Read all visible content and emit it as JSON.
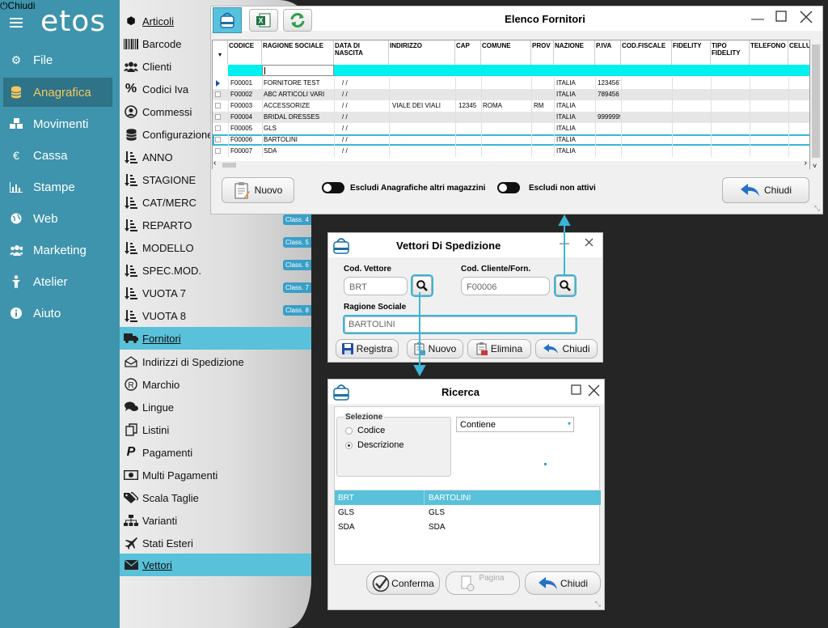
{
  "nav": {
    "logo": "etos",
    "items": [
      {
        "label": "File",
        "icon": "gear-icon",
        "active": false
      },
      {
        "label": "Anagrafica",
        "icon": "database-icon",
        "active": true
      },
      {
        "label": "Movimenti",
        "icon": "cubes-icon",
        "active": false
      },
      {
        "label": "Cassa",
        "icon": "euro-icon",
        "active": false
      },
      {
        "label": "Stampe",
        "icon": "bar-chart-icon",
        "active": false
      },
      {
        "label": "Web",
        "icon": "globe-icon",
        "active": false
      },
      {
        "label": "Marketing",
        "icon": "users-icon",
        "active": false
      },
      {
        "label": "Atelier",
        "icon": "person-icon",
        "active": false
      },
      {
        "label": "Aiuto",
        "icon": "info-icon",
        "active": false
      }
    ],
    "chiudi": "Chiudi"
  },
  "submenu": {
    "items": [
      "Articoli",
      "Barcode",
      "Clienti",
      "Codici Iva",
      "Commessi",
      "Configurazione",
      "ANNO",
      "STAGIONE",
      "CAT/MERC",
      "REPARTO",
      "MODELLO",
      "SPEC.MOD.",
      "VUOTA 7",
      "VUOTA 8",
      "Fornitori",
      "Indirizzi di Spedizione",
      "Marchio",
      "Lingue",
      "Listini",
      "Pagamenti",
      "Multi Pagamenti",
      "Scala Taglie",
      "Varianti",
      "Stati Esteri",
      "Vettori"
    ],
    "badges": [
      "Class. 4",
      "Class. 5",
      "Class. 6",
      "Class. 7",
      "Class. 8"
    ]
  },
  "fornitori": {
    "title": "Elenco Fornitori",
    "columns": [
      "CODICE",
      "RAGIONE SOCIALE",
      "DATA DI NASCITA",
      "INDIRIZZO",
      "CAP",
      "COMUNE",
      "PROV",
      "NAZIONE",
      "P.IVA",
      "COD.FISCALE",
      "FIDELITY",
      "TIPO FIDELITY",
      "TELEFONO",
      "CELLU"
    ],
    "rows": [
      {
        "codice": "F00001",
        "ragione": "FORNITORE TEST",
        "data": "/ /",
        "indirizzo": "",
        "cap": "",
        "comune": "",
        "prov": "",
        "nazione": "ITALIA",
        "piva": "1234567"
      },
      {
        "codice": "F00002",
        "ragione": "ABC ARTICOLI VARI",
        "data": "/ /",
        "indirizzo": "",
        "cap": "",
        "comune": "",
        "prov": "",
        "nazione": "ITALIA",
        "piva": "789456"
      },
      {
        "codice": "F00003",
        "ragione": "ACCESSORIZE",
        "data": "/ /",
        "indirizzo": "VIALE DEI VIALI",
        "cap": "12345",
        "comune": "ROMA",
        "prov": "RM",
        "nazione": "ITALIA",
        "piva": ""
      },
      {
        "codice": "F00004",
        "ragione": "BRIDAL DRESSES",
        "data": "/ /",
        "indirizzo": "",
        "cap": "",
        "comune": "",
        "prov": "",
        "nazione": "ITALIA",
        "piva": "9999999"
      },
      {
        "codice": "F00005",
        "ragione": "GLS",
        "data": "/ /",
        "indirizzo": "",
        "cap": "",
        "comune": "",
        "prov": "",
        "nazione": "ITALIA",
        "piva": ""
      },
      {
        "codice": "F00006",
        "ragione": "BARTOLINI",
        "data": "/ /",
        "indirizzo": "",
        "cap": "",
        "comune": "",
        "prov": "",
        "nazione": "ITALIA",
        "piva": ""
      },
      {
        "codice": "F00007",
        "ragione": "SDA",
        "data": "/ /",
        "indirizzo": "",
        "cap": "",
        "comune": "",
        "prov": "",
        "nazione": "ITALIA",
        "piva": ""
      }
    ],
    "nuovo": "Nuovo",
    "chiudi": "Chiudi",
    "toggle1": "Escludi Anagrafiche altri magazzini",
    "toggle2": "Escludi non attivi"
  },
  "vettori": {
    "title": "Vettori Di Spedizione",
    "cod_vettore_label": "Cod. Vettore",
    "cod_vettore_value": "BRT",
    "cod_cliente_label": "Cod. Cliente/Forn.",
    "cod_cliente_value": "F00006",
    "ragione_label": "Ragione Sociale",
    "ragione_value": "BARTOLINI",
    "registra": "Registra",
    "nuovo": "Nuovo",
    "elimina": "Elimina",
    "chiudi": "Chiudi"
  },
  "ricerca": {
    "title": "Ricerca",
    "selezione": "Selezione",
    "opt_codice": "Codice",
    "opt_descrizione": "Descrizione",
    "mode": "Contiene",
    "rows": [
      {
        "code": "BRT",
        "desc": "BARTOLINI"
      },
      {
        "code": "GLS",
        "desc": "GLS"
      },
      {
        "code": "SDA",
        "desc": "SDA"
      }
    ],
    "conferma": "Conferma",
    "pagina": "Pagina",
    "chiudi": "Chiudi"
  }
}
